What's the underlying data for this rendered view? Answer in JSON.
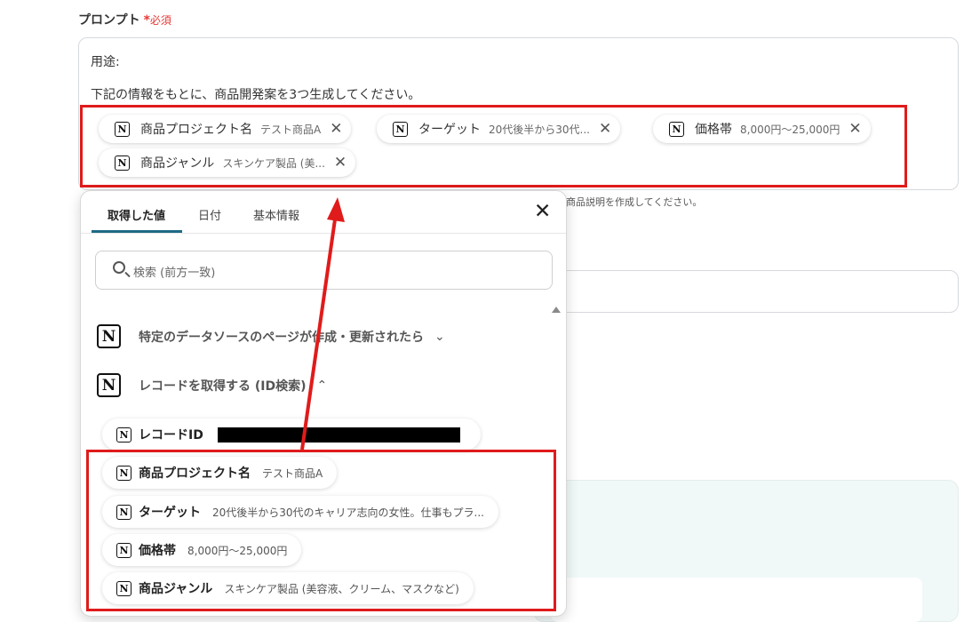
{
  "field": {
    "label": "プロンプト",
    "required_star": "*",
    "required_text": "必須"
  },
  "prompt": {
    "line1": "用途:",
    "line2": "下記の情報をもとに、商品開発案を3つ生成してください。",
    "chips": [
      {
        "name": "商品プロジェクト名",
        "value": "テスト商品A"
      },
      {
        "name": "ターゲット",
        "value": "20代後半から30代..."
      },
      {
        "name": "価格帯",
        "value": "8,000円〜25,000円"
      },
      {
        "name": "商品ジャンル",
        "value": "スキンケア製品 (美..."
      }
    ],
    "notion_glyph": "N",
    "remove_glyph": "✕"
  },
  "behind": {
    "hint_fragment": "商品説明を作成してください。"
  },
  "popup": {
    "tabs": [
      "取得した値",
      "日付",
      "基本情報"
    ],
    "active_tab": 0,
    "close_glyph": "✕",
    "search_placeholder": "検索 (前方一致)",
    "sections": [
      {
        "title": "特定のデータソースのページが作成・更新されたら",
        "chevron": "⌄"
      },
      {
        "title": "レコードを取得する (ID検索)",
        "chevron": "⌃"
      }
    ],
    "items": [
      {
        "label": "レコードID",
        "value": ""
      },
      {
        "label": "商品プロジェクト名",
        "value": "テスト商品A"
      },
      {
        "label": "ターゲット",
        "value": "20代後半から30代のキャリア志向の女性。仕事もプラ..."
      },
      {
        "label": "価格帯",
        "value": "8,000円〜25,000円"
      },
      {
        "label": "商品ジャンル",
        "value": "スキンケア製品 (美容液、クリーム、マスクなど)"
      }
    ]
  },
  "colors": {
    "highlight_red": "#e01b1b",
    "tab_accent": "#1e6a87"
  },
  "icons": [
    "notion-icon",
    "close-icon",
    "search-icon",
    "chevron-down-icon",
    "chevron-up-icon",
    "scroll-up-icon"
  ]
}
